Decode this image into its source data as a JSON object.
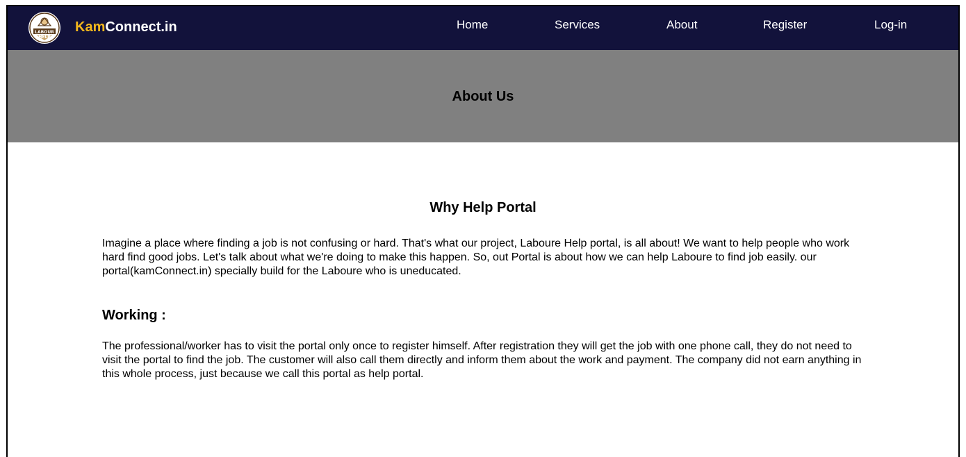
{
  "brand": {
    "logo_text": "LABOUR HELP",
    "name_accent": "Kam",
    "name_rest": "Connect.in"
  },
  "nav": {
    "items": [
      "Home",
      "Services",
      "About",
      "Register",
      "Log-in"
    ]
  },
  "banner": {
    "title": "About Us"
  },
  "content": {
    "heading": "Why Help Portal",
    "intro": "Imagine a place where finding a job is not confusing or hard. That's what our project, Laboure Help portal, is all about! We want to help people who work hard find good jobs. Let's talk about what we're doing to make this happen. So, out Portal is about how we can help Laboure to find job easily. our portal(kamConnect.in) specially build for the Laboure who is uneducated.",
    "working_heading": "Working :",
    "working_text": "The professional/worker has to visit the portal only once to register himself. After registration they will get the job with one phone call, they do not need to visit the portal to find the job. The customer will also call them directly and inform them about the work and payment. The company did not earn anything in this whole process, just because we call this portal as help portal."
  },
  "colors": {
    "navbar_bg": "#12123b",
    "brand_accent": "#f3b71d",
    "banner_bg": "#808080"
  },
  "icons": {
    "logo": "labour-help-logo"
  }
}
